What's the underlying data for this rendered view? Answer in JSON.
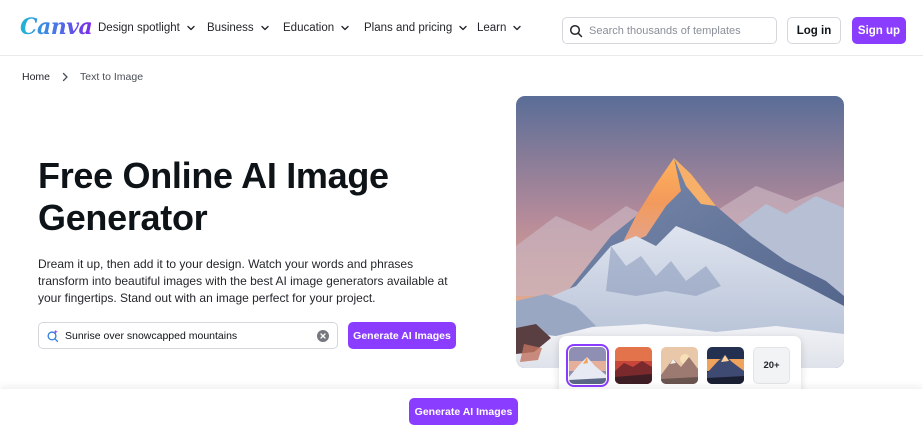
{
  "brand": {
    "name": "Canva",
    "accent": "#8b3dff"
  },
  "header": {
    "nav": [
      {
        "label": "Design spotlight"
      },
      {
        "label": "Business"
      },
      {
        "label": "Education"
      },
      {
        "label": "Plans and pricing"
      },
      {
        "label": "Learn"
      }
    ],
    "search": {
      "placeholder": "Search thousands of templates",
      "icon": "search-icon"
    },
    "login_label": "Log in",
    "signup_label": "Sign up"
  },
  "breadcrumb": {
    "home": "Home",
    "current": "Text to Image"
  },
  "hero": {
    "title": "Free Online AI Image Generator",
    "description": "Dream it up, then add it to your design. Watch your words and phrases transform into beautiful images with the best AI image generators available at your fingertips. Stand out with an image perfect for your project.",
    "prompt_value": "Sunrise over snowcapped mountains",
    "generate_label": "Generate AI Images",
    "image_alt": "Sunrise over snowcapped mountains",
    "thumbnails": [
      "sunrise-mountain",
      "red-sunset-mountain",
      "painted-mountain",
      "dusk-mountain"
    ],
    "more_label": "20+"
  },
  "bottom_bar": {
    "generate_label": "Generate AI Images"
  }
}
